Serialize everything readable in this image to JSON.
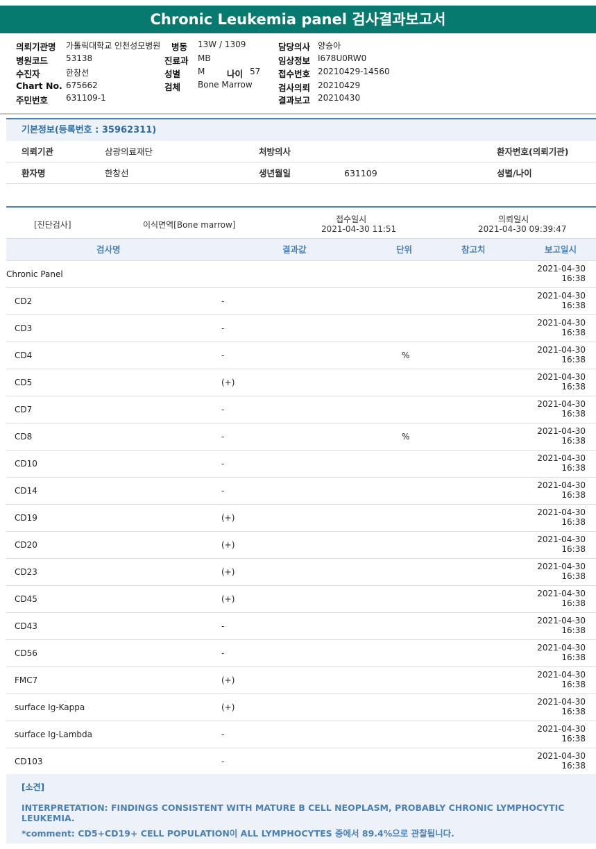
{
  "title": "Chronic Leukemia panel 검사결과보고서",
  "header": {
    "institution_label": "의뢰기관명",
    "institution_value": "가톨릭대학교 인천성모병원",
    "ward_label": "병동",
    "ward_value": "13W / 1309",
    "doctor_label": "담당의사",
    "doctor_value": "양승아",
    "hospital_code_label": "병원코드",
    "hospital_code_value": "53138",
    "dept_label": "진료과",
    "dept_value": "MB",
    "clinical_info_label": "임상정보",
    "clinical_info_value": "I678U0RW0",
    "examinee_label": "수진자",
    "examinee_value": "한창선",
    "sex_label": "성별",
    "sex_value": "M",
    "age_label": "나이",
    "age_value": "57",
    "receipt_no_label": "접수번호",
    "receipt_no_value": "20210429-14560",
    "chart_label": "Chart No.",
    "chart_value": "675662",
    "specimen_label": "검체",
    "specimen_value": "Bone Marrow",
    "request_label": "검사의뢰",
    "request_value": "20210429",
    "resident_label": "주민번호",
    "resident_value": "631109-1",
    "report_label": "결과보고",
    "report_value": "20210430"
  },
  "basic_info": {
    "title": "기본정보(등록번호 : 35962311)",
    "inst_key": "의뢰기관",
    "inst_val": "삼광의료재단",
    "prescriber_key": "처방의사",
    "patient_no_key": "환자번호(의뢰기관)",
    "patient_key": "환자명",
    "patient_val": "한창선",
    "birth_key": "생년월일",
    "birth_val": "631109",
    "sexage_key": "성별/나이"
  },
  "exam": {
    "type": "[진단검사]",
    "name": "이식면역[Bone marrow]",
    "received_label": "접수일시",
    "received_value": "2021-04-30  11:51",
    "requested_label": "의뢰일시",
    "requested_value": "2021-04-30  09:39:47"
  },
  "columns": {
    "name": "검사명",
    "result": "결과값",
    "unit": "단위",
    "reference": "참고치",
    "report_date": "보고일시"
  },
  "rows": [
    {
      "name": "Chronic Panel",
      "result": "",
      "unit": "",
      "date": "2021-04-30",
      "time": "16:38"
    },
    {
      "name": "CD2",
      "result": "-",
      "unit": "",
      "date": "2021-04-30",
      "time": "16:38"
    },
    {
      "name": "CD3",
      "result": "-",
      "unit": "",
      "date": "2021-04-30",
      "time": "16:38"
    },
    {
      "name": "CD4",
      "result": "-",
      "unit": "%",
      "date": "2021-04-30",
      "time": "16:38"
    },
    {
      "name": "CD5",
      "result": "(+)",
      "unit": "",
      "date": "2021-04-30",
      "time": "16:38"
    },
    {
      "name": "CD7",
      "result": "-",
      "unit": "",
      "date": "2021-04-30",
      "time": "16:38"
    },
    {
      "name": "CD8",
      "result": "-",
      "unit": "%",
      "date": "2021-04-30",
      "time": "16:38"
    },
    {
      "name": "CD10",
      "result": "-",
      "unit": "",
      "date": "2021-04-30",
      "time": "16:38"
    },
    {
      "name": "CD14",
      "result": "-",
      "unit": "",
      "date": "2021-04-30",
      "time": "16:38"
    },
    {
      "name": "CD19",
      "result": "(+)",
      "unit": "",
      "date": "2021-04-30",
      "time": "16:38"
    },
    {
      "name": "CD20",
      "result": "(+)",
      "unit": "",
      "date": "2021-04-30",
      "time": "16:38"
    },
    {
      "name": "CD23",
      "result": "(+)",
      "unit": "",
      "date": "2021-04-30",
      "time": "16:38"
    },
    {
      "name": "CD45",
      "result": "(+)",
      "unit": "",
      "date": "2021-04-30",
      "time": "16:38"
    },
    {
      "name": "CD43",
      "result": "-",
      "unit": "",
      "date": "2021-04-30",
      "time": "16:38"
    },
    {
      "name": "CD56",
      "result": "-",
      "unit": "",
      "date": "2021-04-30",
      "time": "16:38"
    },
    {
      "name": "FMC7",
      "result": "(+)",
      "unit": "",
      "date": "2021-04-30",
      "time": "16:38"
    },
    {
      "name": "surface Ig-Kappa",
      "result": "(+)",
      "unit": "",
      "date": "2021-04-30",
      "time": "16:38"
    },
    {
      "name": "surface Ig-Lambda",
      "result": "-",
      "unit": "",
      "date": "2021-04-30",
      "time": "16:38"
    },
    {
      "name": "CD103",
      "result": "-",
      "unit": "",
      "date": "2021-04-30",
      "time": "16:38"
    }
  ],
  "footer": {
    "section": "[소견]",
    "interpretation": "INTERPRETATION: FINDINGS CONSISTENT WITH MATURE B CELL NEOPLASM, PROBABLY CHRONIC LYMPHOCYTIC LEUKEMIA.",
    "comment": "*comment: CD5+CD19+ CELL POPULATION이 ALL LYMPHOCYTES 중에서 89.4%으로 관찰됩니다."
  }
}
